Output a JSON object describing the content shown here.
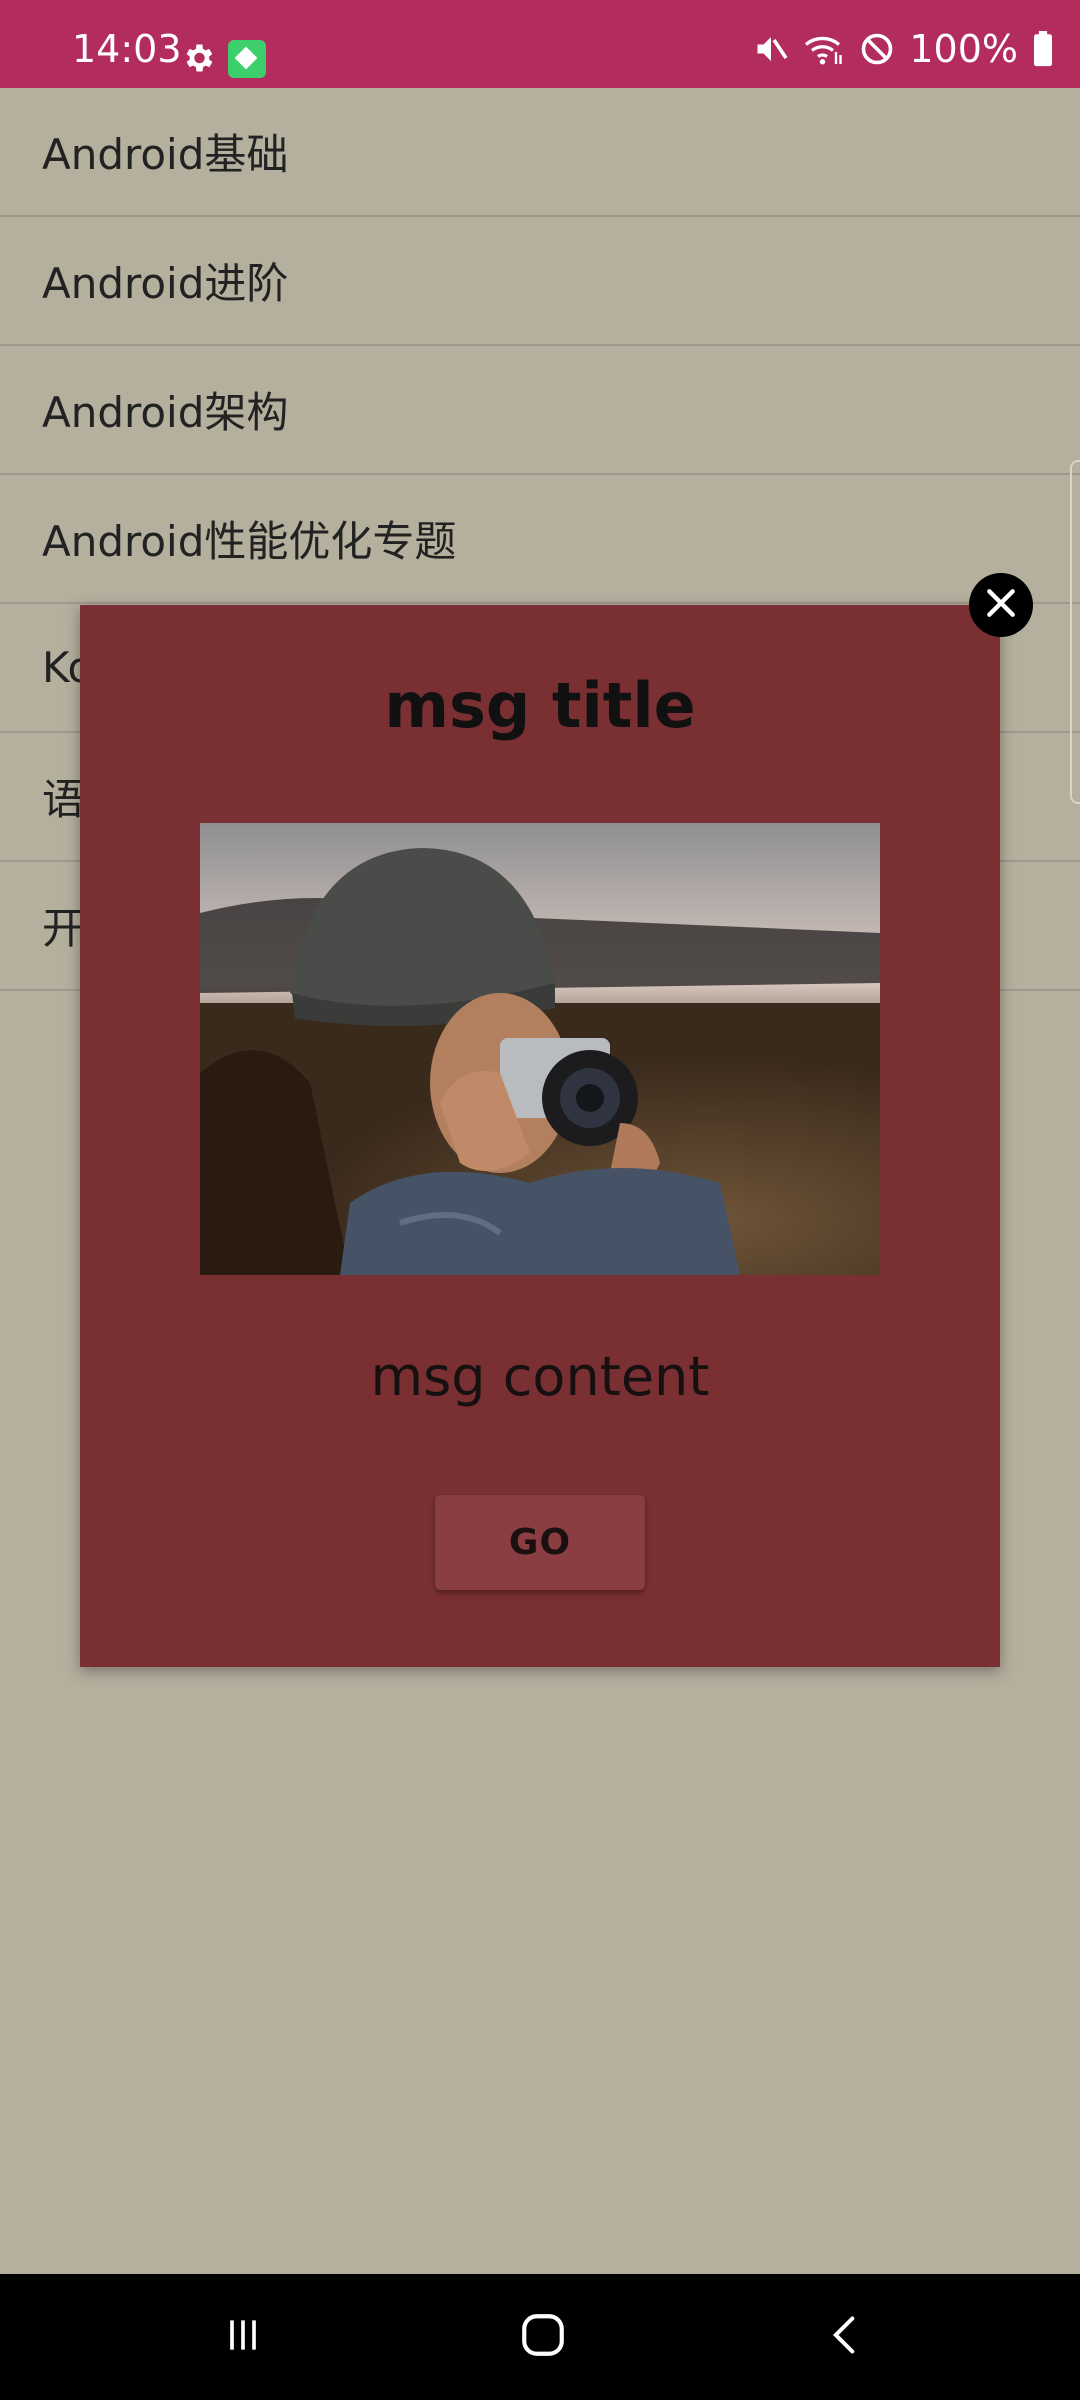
{
  "status_bar": {
    "time": "14:03",
    "battery_percent": "100%",
    "background_color": "#b32c5e",
    "icons": [
      "gear-icon",
      "app-notification-icon",
      "mute-icon",
      "wifi-icon",
      "do-not-disturb-icon",
      "battery-icon"
    ]
  },
  "list": {
    "items": [
      {
        "label": "Android基础"
      },
      {
        "label": "Android进阶"
      },
      {
        "label": "Android架构"
      },
      {
        "label": "Android性能优化专题"
      },
      {
        "label": "Ko"
      },
      {
        "label": "语"
      },
      {
        "label": "开"
      }
    ]
  },
  "dialog": {
    "title": "msg title",
    "content": "msg content",
    "button_label": "GO",
    "background_color": "#7a3032",
    "image_description_icon": "photo-image"
  },
  "nav_bar": {
    "buttons": [
      "recent-apps-icon",
      "home-icon",
      "back-icon"
    ]
  }
}
